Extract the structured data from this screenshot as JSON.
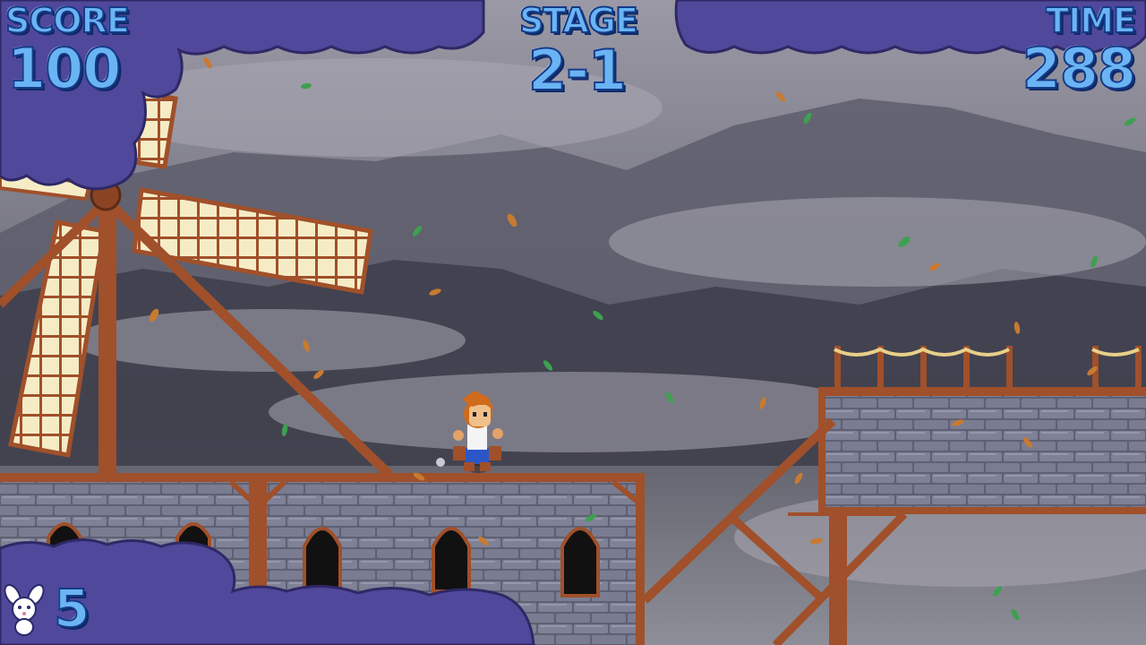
{
  "hud": {
    "score_label": "SCORE",
    "score_value": "100",
    "stage_label": "STAGE",
    "stage_value": "2-1",
    "time_label": "TIME",
    "time_value": "288",
    "lives_value": "5",
    "lives_icon": "bunny-lives-icon"
  },
  "colors": {
    "hud_text": "#6ab4f4",
    "hud_outline": "#153a88",
    "cloud_purple": "#50489a",
    "stone": "#7d7f93",
    "wood": "#a0502a",
    "sky": "#6b6b78"
  }
}
